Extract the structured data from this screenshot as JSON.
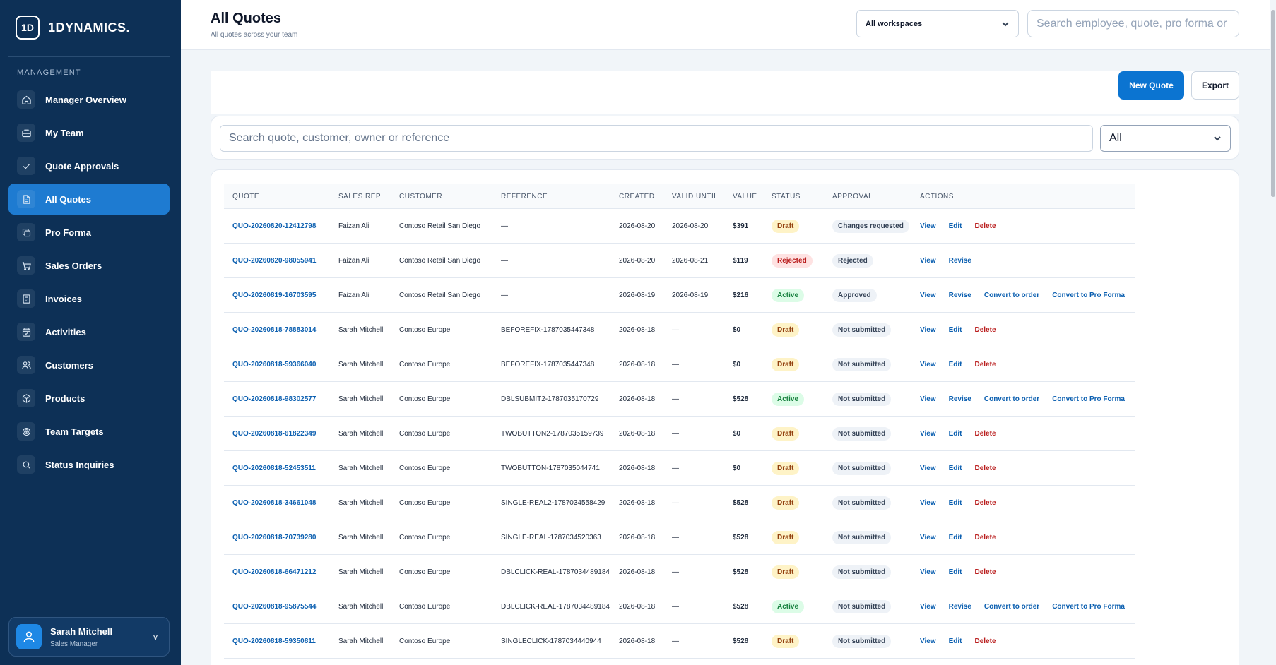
{
  "sidebar": {
    "logo_mark": "1D",
    "logo_text": "1DYNAMICS.",
    "section": "MANAGEMENT",
    "items": [
      {
        "label": "Manager Overview",
        "icon": "home-icon"
      },
      {
        "label": "My Team",
        "icon": "briefcase-icon"
      },
      {
        "label": "Quote Approvals",
        "icon": "check-icon"
      },
      {
        "label": "All Quotes",
        "icon": "document-icon",
        "active": true
      },
      {
        "label": "Pro Forma",
        "icon": "copy-icon"
      },
      {
        "label": "Sales Orders",
        "icon": "cart-icon"
      },
      {
        "label": "Invoices",
        "icon": "receipt-icon"
      },
      {
        "label": "Activities",
        "icon": "calendar-icon"
      },
      {
        "label": "Customers",
        "icon": "users-icon"
      },
      {
        "label": "Products",
        "icon": "box-icon"
      },
      {
        "label": "Team Targets",
        "icon": "target-icon"
      },
      {
        "label": "Status Inquiries",
        "icon": "search-icon"
      }
    ],
    "user": {
      "name": "Sarah Mitchell",
      "role": "Sales Manager",
      "chevron": "v"
    }
  },
  "header": {
    "title": "All Quotes",
    "subtitle": "All quotes across your team",
    "workspace_select": "All workspaces",
    "search_placeholder": "Search employee, quote, pro forma or"
  },
  "toolbar": {
    "new_quote": "New Quote",
    "export": "Export"
  },
  "filters": {
    "search_placeholder": "Search quote, customer, owner or reference",
    "status_select": "All"
  },
  "table": {
    "columns": [
      "QUOTE",
      "SALES REP",
      "CUSTOMER",
      "REFERENCE",
      "CREATED",
      "VALID UNTIL",
      "VALUE",
      "STATUS",
      "APPROVAL",
      "ACTIONS"
    ],
    "rows": [
      {
        "quote": "QUO-20260820-12412798",
        "rep": "Faizan Ali",
        "customer": "Contoso Retail San Diego",
        "reference": "—",
        "created": "2026-08-20",
        "valid": "2026-08-20",
        "value": "$391",
        "status": "Draft",
        "approval": "Changes requested",
        "actions": [
          "View",
          "Edit",
          "Delete"
        ]
      },
      {
        "quote": "QUO-20260820-98055941",
        "rep": "Faizan Ali",
        "customer": "Contoso Retail San Diego",
        "reference": "—",
        "created": "2026-08-20",
        "valid": "2026-08-21",
        "value": "$119",
        "status": "Rejected",
        "approval": "Rejected",
        "actions": [
          "View",
          "Revise"
        ]
      },
      {
        "quote": "QUO-20260819-16703595",
        "rep": "Faizan Ali",
        "customer": "Contoso Retail San Diego",
        "reference": "—",
        "created": "2026-08-19",
        "valid": "2026-08-19",
        "value": "$216",
        "status": "Active",
        "approval": "Approved",
        "actions": [
          "View",
          "Revise",
          "Convert to order",
          "Convert to Pro Forma"
        ]
      },
      {
        "quote": "QUO-20260818-78883014",
        "rep": "Sarah Mitchell",
        "customer": "Contoso Europe",
        "reference": "BEFOREFIX-1787035447348",
        "created": "2026-08-18",
        "valid": "—",
        "value": "$0",
        "status": "Draft",
        "approval": "Not submitted",
        "actions": [
          "View",
          "Edit",
          "Delete"
        ]
      },
      {
        "quote": "QUO-20260818-59366040",
        "rep": "Sarah Mitchell",
        "customer": "Contoso Europe",
        "reference": "BEFOREFIX-1787035447348",
        "created": "2026-08-18",
        "valid": "—",
        "value": "$0",
        "status": "Draft",
        "approval": "Not submitted",
        "actions": [
          "View",
          "Edit",
          "Delete"
        ]
      },
      {
        "quote": "QUO-20260818-98302577",
        "rep": "Sarah Mitchell",
        "customer": "Contoso Europe",
        "reference": "DBLSUBMIT2-1787035170729",
        "created": "2026-08-18",
        "valid": "—",
        "value": "$528",
        "status": "Active",
        "approval": "Not submitted",
        "actions": [
          "View",
          "Revise",
          "Convert to order",
          "Convert to Pro Forma"
        ]
      },
      {
        "quote": "QUO-20260818-61822349",
        "rep": "Sarah Mitchell",
        "customer": "Contoso Europe",
        "reference": "TWOBUTTON2-1787035159739",
        "created": "2026-08-18",
        "valid": "—",
        "value": "$0",
        "status": "Draft",
        "approval": "Not submitted",
        "actions": [
          "View",
          "Edit",
          "Delete"
        ]
      },
      {
        "quote": "QUO-20260818-52453511",
        "rep": "Sarah Mitchell",
        "customer": "Contoso Europe",
        "reference": "TWOBUTTON-1787035044741",
        "created": "2026-08-18",
        "valid": "—",
        "value": "$0",
        "status": "Draft",
        "approval": "Not submitted",
        "actions": [
          "View",
          "Edit",
          "Delete"
        ]
      },
      {
        "quote": "QUO-20260818-34661048",
        "rep": "Sarah Mitchell",
        "customer": "Contoso Europe",
        "reference": "SINGLE-REAL2-1787034558429",
        "created": "2026-08-18",
        "valid": "—",
        "value": "$528",
        "status": "Draft",
        "approval": "Not submitted",
        "actions": [
          "View",
          "Edit",
          "Delete"
        ]
      },
      {
        "quote": "QUO-20260818-70739280",
        "rep": "Sarah Mitchell",
        "customer": "Contoso Europe",
        "reference": "SINGLE-REAL-1787034520363",
        "created": "2026-08-18",
        "valid": "—",
        "value": "$528",
        "status": "Draft",
        "approval": "Not submitted",
        "actions": [
          "View",
          "Edit",
          "Delete"
        ]
      },
      {
        "quote": "QUO-20260818-66471212",
        "rep": "Sarah Mitchell",
        "customer": "Contoso Europe",
        "reference": "DBLCLICK-REAL-1787034489184",
        "created": "2026-08-18",
        "valid": "—",
        "value": "$528",
        "status": "Draft",
        "approval": "Not submitted",
        "actions": [
          "View",
          "Edit",
          "Delete"
        ]
      },
      {
        "quote": "QUO-20260818-95875544",
        "rep": "Sarah Mitchell",
        "customer": "Contoso Europe",
        "reference": "DBLCLICK-REAL-1787034489184",
        "created": "2026-08-18",
        "valid": "—",
        "value": "$528",
        "status": "Active",
        "approval": "Not submitted",
        "actions": [
          "View",
          "Revise",
          "Convert to order",
          "Convert to Pro Forma"
        ]
      },
      {
        "quote": "QUO-20260818-59350811",
        "rep": "Sarah Mitchell",
        "customer": "Contoso Europe",
        "reference": "SINGLECLICK-1787034440944",
        "created": "2026-08-18",
        "valid": "—",
        "value": "$528",
        "status": "Draft",
        "approval": "Not submitted",
        "actions": [
          "View",
          "Edit",
          "Delete"
        ]
      }
    ]
  },
  "colors": {
    "sidebar": "#0d3056",
    "accent": "#1e7bd1",
    "primary_button": "#0b74d1",
    "link": "#0b5fb0",
    "danger": "#b91c1c"
  }
}
